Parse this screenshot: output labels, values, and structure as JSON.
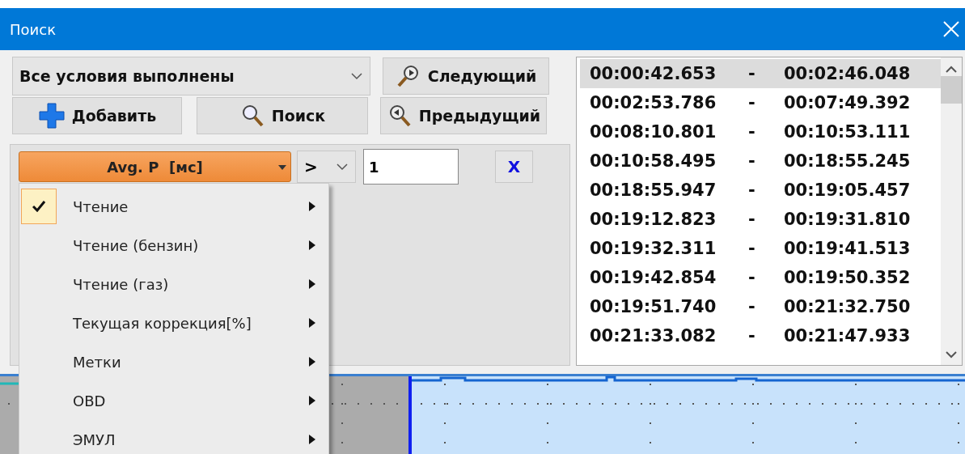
{
  "window": {
    "title": "Поиск"
  },
  "match_mode": {
    "value": "Все условия выполнены"
  },
  "next_button": {
    "label": "Следующий"
  },
  "add_button": {
    "label": "Добавить"
  },
  "search_button": {
    "label": "Поиск"
  },
  "previous_button": {
    "label": "Предыдущий"
  },
  "condition": {
    "parameter": "Avg. P  [мс]",
    "operator": ">",
    "value": "1",
    "remove": "X"
  },
  "parameter_menu": [
    {
      "label": "Чтение",
      "checked": true
    },
    {
      "label": "Чтение (бензин)",
      "checked": false
    },
    {
      "label": "Чтение (газ)",
      "checked": false
    },
    {
      "label": "Текущая коррекция[%]",
      "checked": false
    },
    {
      "label": "Метки",
      "checked": false
    },
    {
      "label": "OBD",
      "checked": false
    },
    {
      "label": "ЭМУЛ",
      "checked": false
    }
  ],
  "results": [
    {
      "start": "00:00:42.653",
      "separator": "-",
      "end": "00:02:46.048",
      "selected": true
    },
    {
      "start": "00:02:53.786",
      "separator": "-",
      "end": "00:07:49.392",
      "selected": false
    },
    {
      "start": "00:08:10.801",
      "separator": "-",
      "end": "00:10:53.111",
      "selected": false
    },
    {
      "start": "00:10:58.495",
      "separator": "-",
      "end": "00:18:55.245",
      "selected": false
    },
    {
      "start": "00:18:55.947",
      "separator": "-",
      "end": "00:19:05.457",
      "selected": false
    },
    {
      "start": "00:19:12.823",
      "separator": "-",
      "end": "00:19:31.810",
      "selected": false
    },
    {
      "start": "00:19:32.311",
      "separator": "-",
      "end": "00:19:41.513",
      "selected": false
    },
    {
      "start": "00:19:42.854",
      "separator": "-",
      "end": "00:19:50.352",
      "selected": false
    },
    {
      "start": "00:19:51.740",
      "separator": "-",
      "end": "00:21:32.750",
      "selected": false
    },
    {
      "start": "00:21:33.082",
      "separator": "-",
      "end": "00:21:47.933",
      "selected": false
    }
  ]
}
